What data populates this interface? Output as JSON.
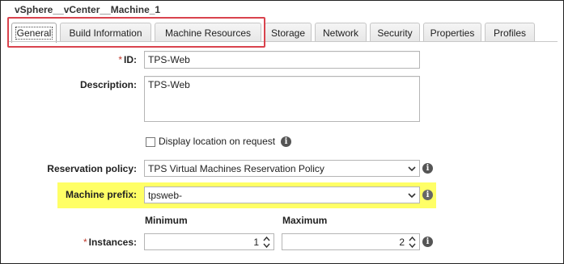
{
  "window": {
    "title": "vSphere__vCenter__Machine_1"
  },
  "tabs": [
    {
      "label": "General",
      "active": true
    },
    {
      "label": "Build Information"
    },
    {
      "label": "Machine Resources"
    },
    {
      "label": "Storage"
    },
    {
      "label": "Network"
    },
    {
      "label": "Security"
    },
    {
      "label": "Properties"
    },
    {
      "label": "Profiles"
    }
  ],
  "form": {
    "id": {
      "label": "ID:",
      "required_mark": "*",
      "value": "TPS-Web"
    },
    "description": {
      "label": "Description:",
      "value": "TPS-Web"
    },
    "display_location": {
      "label": "Display location on request",
      "checked": false
    },
    "reservation_policy": {
      "label": "Reservation policy:",
      "value": "TPS Virtual Machines Reservation Policy"
    },
    "machine_prefix": {
      "label": "Machine prefix:",
      "value": "tpsweb-"
    },
    "instances": {
      "label": "Instances:",
      "required_mark": "*",
      "minimum_header": "Minimum",
      "maximum_header": "Maximum",
      "minimum": "1",
      "maximum": "2"
    }
  },
  "icons": {
    "info": "info-icon",
    "dropdown": "chevron-down-icon",
    "spinner": "spinner-arrows-icon"
  },
  "colors": {
    "highlight_red": "#d9434d",
    "highlight_yellow": "#ffff66"
  }
}
